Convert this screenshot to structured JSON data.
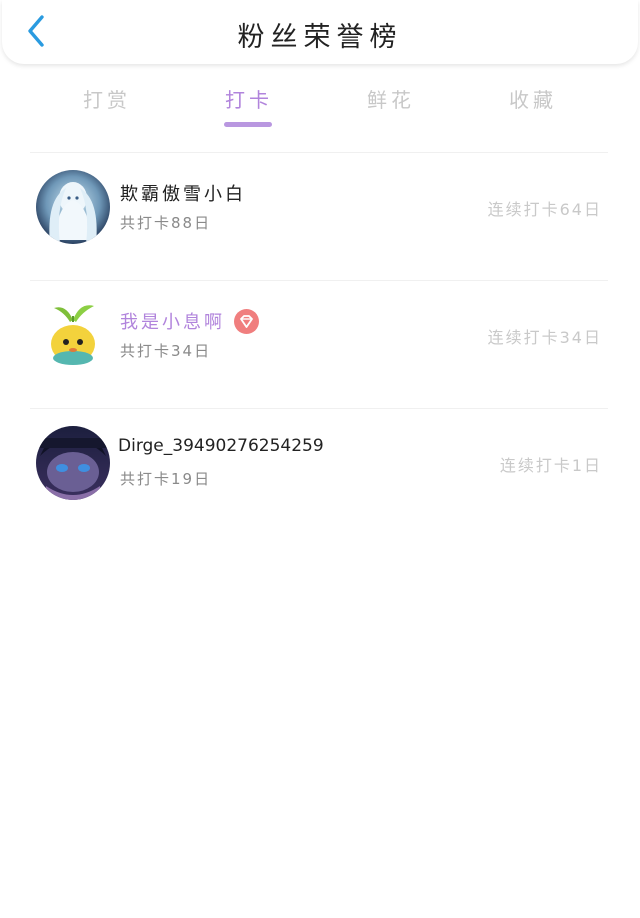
{
  "header": {
    "title": "粉丝荣誉榜",
    "back_icon": "chevron-left-icon"
  },
  "tabs": [
    {
      "label": "打赏",
      "active": false
    },
    {
      "label": "打卡",
      "active": true
    },
    {
      "label": "鲜花",
      "active": false
    },
    {
      "label": "收藏",
      "active": false
    }
  ],
  "colors": {
    "accent": "#b184dc",
    "back_icon": "#2a9be0",
    "badge": "#f07e7e",
    "muted": "#c9c9c9"
  },
  "entries": [
    {
      "name": "欺霸傲雪小白",
      "total": "共打卡88日",
      "streak": "连续打卡64日",
      "highlight": false,
      "badge": null
    },
    {
      "name": "我是小息啊",
      "total": "共打卡34日",
      "streak": "连续打卡34日",
      "highlight": true,
      "badge": "diamond-icon"
    },
    {
      "name": "Dirge_39490276254259",
      "total": "共打卡19日",
      "streak": "连续打卡1日",
      "highlight": false,
      "badge": null
    }
  ]
}
